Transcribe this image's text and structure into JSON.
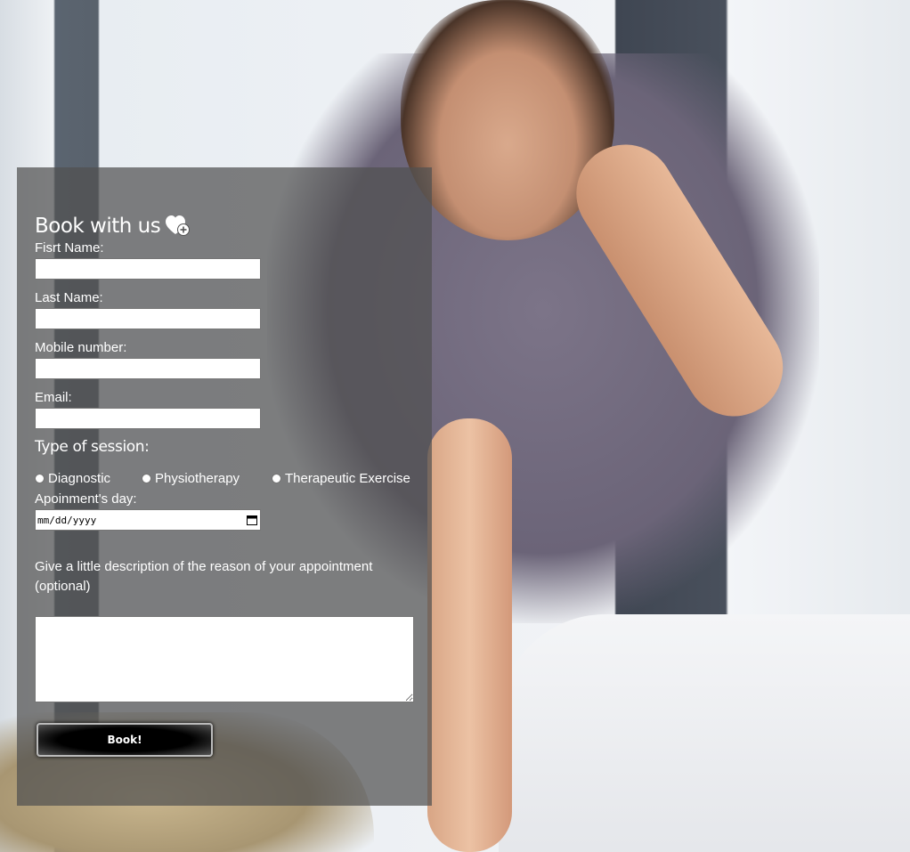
{
  "booking": {
    "title": "Book with us",
    "title_icon": "heart-plus-icon",
    "first_name_label": "Fisrt Name:",
    "first_name_value": "",
    "last_name_label": "Last Name:",
    "last_name_value": "",
    "mobile_label": "Mobile number:",
    "mobile_value": "",
    "email_label": "Email:",
    "email_value": "",
    "session_title": "Type of session:",
    "session_options": [
      "Diagnostic",
      "Physiotherapy",
      "Therapeutic Exercise"
    ],
    "date_label": "Apoinment's day:",
    "date_placeholder": "mm/dd/yyyy",
    "description_label": "Give a little description of the reason of your appointment (optional)",
    "description_value": "",
    "submit_label": "Book!"
  },
  "colors": {
    "panel_bg": "rgba(80,80,80,0.72)",
    "button_bg": "#000000",
    "text": "#ffffff"
  }
}
